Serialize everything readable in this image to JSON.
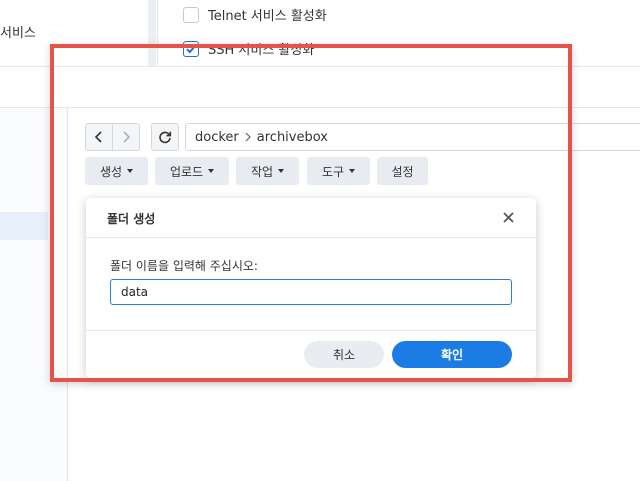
{
  "background_panel": {
    "left_label": "서비스",
    "left_label_partial": "·",
    "options": [
      {
        "label": "Telnet 서비스 활성화",
        "checked": false
      },
      {
        "label": "SSH 서비스 활성화",
        "checked": true
      }
    ]
  },
  "file_station": {
    "path": [
      "docker",
      "archivebox"
    ],
    "toolbar": {
      "create": "생성",
      "upload": "업로드",
      "action": "작업",
      "tools": "도구",
      "settings": "설정"
    }
  },
  "dialog": {
    "title": "폴더 생성",
    "prompt": "폴더 이름을 입력해 주십시오:",
    "input_value": "data",
    "cancel_label": "취소",
    "ok_label": "확인"
  },
  "colors": {
    "accent": "#1c7ce5",
    "annotation_frame": "#e5534b"
  },
  "icons": [
    "back-icon",
    "forward-icon",
    "refresh-icon",
    "path-separator-icon",
    "caret-down-icon",
    "close-icon",
    "checkmark-icon"
  ]
}
